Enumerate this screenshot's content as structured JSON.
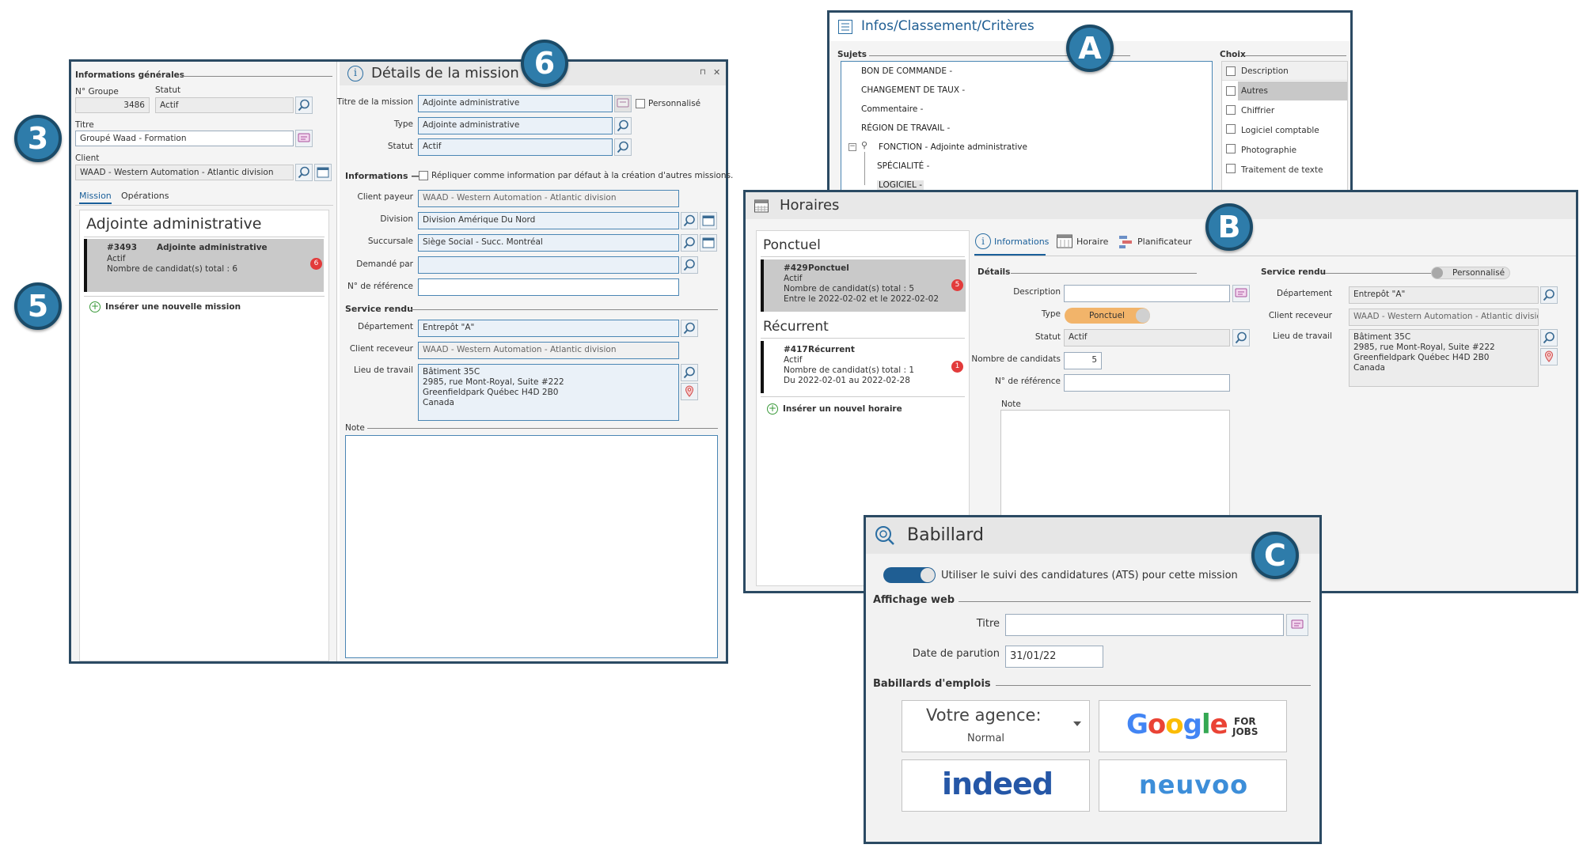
{
  "callouts": {
    "c3": "3",
    "c5": "5",
    "c6": "6",
    "ca": "A",
    "cb": "B",
    "cc": "C"
  },
  "mission_window": {
    "general": {
      "section": "Informations générales",
      "group_no_label": "N° Groupe",
      "group_no": "3486",
      "status_label": "Statut",
      "status": "Actif",
      "title_label": "Titre",
      "title": "Groupé Waad - Formation",
      "client_label": "Client",
      "client": "WAAD - Western Automation - Atlantic division"
    },
    "tabs": [
      "Mission",
      "Opérations"
    ],
    "list": {
      "heading": "Adjointe administrative",
      "item": {
        "id": "#3493",
        "name": "Adjointe administrative",
        "status": "Actif",
        "count_text": "Nombre de candidat(s) total : 6",
        "badge": "6"
      },
      "insert": "Insérer une nouvelle mission"
    },
    "details": {
      "header": "Détails de la mission",
      "pin": "⊓",
      "close": "✕",
      "title_label": "Titre de la mission",
      "title": "Adjointe administrative",
      "custom": "Personnalisé",
      "type_label": "Type",
      "type": "Adjointe administrative",
      "status_label": "Statut",
      "status": "Actif",
      "info_section": "Informations —",
      "replicate": "Répliquer comme information par défaut à la création d'autres missions.",
      "payer_label": "Client payeur",
      "payer": "WAAD - Western Automation - Atlantic division",
      "division_label": "Division",
      "division": "Division Amérique Du Nord",
      "branch_label": "Succursale",
      "branch": "Siège Social - Succ. Montréal",
      "requested_label": "Demandé par",
      "requested": "",
      "ref_label": "N° de référence",
      "ref": "",
      "service_section": "Service rendu",
      "dept_label": "Département",
      "dept": "Entrepôt \"A\"",
      "receiver_label": "Client receveur",
      "receiver": "WAAD - Western Automation - Atlantic division",
      "workplace_label": "Lieu de travail",
      "workplace": [
        "Bâtiment 35C",
        "2985, rue Mont-Royal, Suite #222",
        "Greenfieldpark Québec H4D 2B0",
        "Canada"
      ],
      "note_label": "Note"
    }
  },
  "infos_window": {
    "title": "Infos/Classement/Critères",
    "subjects_label": "Sujets",
    "choices_label": "Choix",
    "tree": [
      "BON DE COMMANDE -",
      "CHANGEMENT DE TAUX -",
      "Commentaire -",
      "RÉGION DE TRAVAIL -",
      "FONCTION - Adjointe administrative",
      "SPÉCIALITÉ -",
      "LOGICIEL -"
    ],
    "choices_header": "Description",
    "choices": [
      "Autres",
      "Chiffrier",
      "Logiciel comptable",
      "Photographie",
      "Traitement de texte"
    ]
  },
  "horaires_window": {
    "title": "Horaires",
    "ponctuel_heading": "Ponctuel",
    "ponctuel_item": {
      "id": "#429",
      "name": "Ponctuel",
      "status": "Actif",
      "count_text": "Nombre de candidat(s) total : 5",
      "dates": "Entre le 2022-02-02 et le 2022-02-02",
      "badge": "5"
    },
    "recurrent_heading": "Récurrent",
    "recurrent_item": {
      "id": "#417",
      "name": "Récurrent",
      "status": "Actif",
      "count_text": "Nombre de candidat(s) total : 1",
      "dates": "Du 2022-02-01 au 2022-02-28",
      "badge": "1"
    },
    "insert": "Insérer un nouvel horaire",
    "tabs": [
      "Informations",
      "Horaire",
      "Planificateur"
    ],
    "details_section": "Détails",
    "desc_label": "Description",
    "type_label": "Type",
    "type": "Ponctuel",
    "status_label": "Statut",
    "status": "Actif",
    "count_label": "Nombre de candidats",
    "count": "5",
    "ref_label": "N° de référence",
    "note_label": "Note",
    "service_section": "Service rendu",
    "custom": "Personnalisé",
    "dept_label": "Département",
    "dept": "Entrepôt \"A\"",
    "receiver_label": "Client receveur",
    "receiver": "WAAD - Western Automation - Atlantic division",
    "workplace_label": "Lieu de travail",
    "workplace": [
      "Bâtiment 35C",
      "2985, rue Mont-Royal, Suite #222",
      "Greenfieldpark Québec H4D 2B0",
      "Canada"
    ]
  },
  "babillard_window": {
    "title": "Babillard",
    "ats": "Utiliser le suivi des candidatures (ATS) pour cette mission",
    "web_section": "Affichage web",
    "title_label": "Titre",
    "date_label": "Date de parution",
    "date": "31/01/22",
    "boards_section": "Babillards d'emplois",
    "agency": "Votre agence:",
    "agency_sub": "Normal",
    "google": "Google",
    "google_for": "FOR",
    "google_jobs": "JOBS",
    "indeed": "indeed",
    "neuvoo": "neuvoo"
  }
}
